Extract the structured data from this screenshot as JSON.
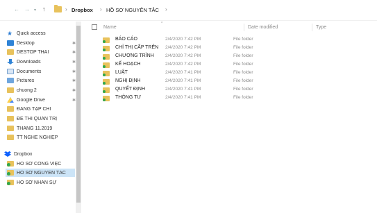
{
  "address_bar": {
    "back_icon": "arrow-left-icon",
    "forward_icon": "arrow-right-icon",
    "up_icon": "arrow-up-icon",
    "crumbs": [
      "Dropbox",
      "HỒ SƠ NGUYÊN TẮC"
    ],
    "separator": "›"
  },
  "nav_pane": {
    "items": [
      {
        "label": "Quick access",
        "icon": "star-icon"
      },
      {
        "label": "Desktop",
        "icon": "desktop-icon",
        "pinned": "✱"
      },
      {
        "label": "DESTOP THAI",
        "icon": "folder-icon",
        "pinned": "✱"
      },
      {
        "label": "Downloads",
        "icon": "download-icon",
        "pinned": "✱"
      },
      {
        "label": "Documents",
        "icon": "documents-icon",
        "pinned": "✱"
      },
      {
        "label": "Pictures",
        "icon": "pictures-icon",
        "pinned": "✱"
      },
      {
        "label": "chuong 2",
        "icon": "folder-icon",
        "pinned": "✱"
      },
      {
        "label": "Google Drive",
        "icon": "google-drive-icon",
        "pinned": "✱"
      },
      {
        "label": "ĐĂNG TẠP CHÍ",
        "icon": "folder-icon"
      },
      {
        "label": "ĐỀ THI QUẢN TRỊ",
        "icon": "folder-icon"
      },
      {
        "label": "THANG 11.2019",
        "icon": "folder-icon"
      },
      {
        "label": "TT NGHỀ NGHIỆP",
        "icon": "folder-icon"
      },
      {
        "label": "Dropbox",
        "icon": "dropbox-icon"
      },
      {
        "label": "HỒ SƠ CÔNG VIỆC",
        "icon": "synced-folder-icon"
      },
      {
        "label": "HỒ SƠ NGUYÊN TẮC",
        "icon": "synced-folder-icon"
      },
      {
        "label": "HỒ SƠ NHÂN SỰ",
        "icon": "synced-folder-icon"
      }
    ]
  },
  "file_list": {
    "columns": {
      "name": "Name",
      "date": "Date modified",
      "type": "Type"
    },
    "rows": [
      {
        "name": "BÁO CÁO",
        "date": "2/4/2020 7:42 PM",
        "type": "File folder"
      },
      {
        "name": "CHỈ THỊ CẤP TRÊN",
        "date": "2/4/2020 7:42 PM",
        "type": "File folder"
      },
      {
        "name": "CHƯƠNG TRÌNH",
        "date": "2/4/2020 7:42 PM",
        "type": "File folder"
      },
      {
        "name": "KẾ HOẠCH",
        "date": "2/4/2020 7:42 PM",
        "type": "File folder"
      },
      {
        "name": "LUẬT",
        "date": "2/4/2020 7:41 PM",
        "type": "File folder"
      },
      {
        "name": "NGHỊ ĐỊNH",
        "date": "2/4/2020 7:41 PM",
        "type": "File folder"
      },
      {
        "name": "QUYẾT ĐỊNH",
        "date": "2/4/2020 7:41 PM",
        "type": "File folder"
      },
      {
        "name": "THÔNG TƯ",
        "date": "2/4/2020 7:41 PM",
        "type": "File folder"
      }
    ]
  },
  "colors": {
    "folder": "#e8c25c",
    "sync_badge": "#2fa84f",
    "selection": "#cce4f7",
    "accent": "#2b7cd3"
  }
}
